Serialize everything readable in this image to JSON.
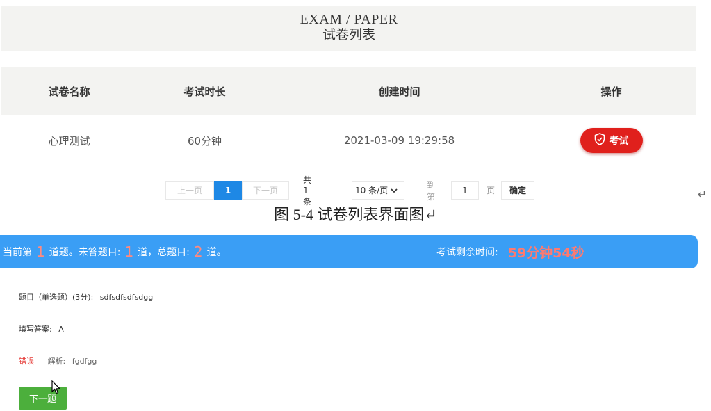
{
  "header": {
    "title_en": "EXAM / PAPER",
    "title_zh": "试卷列表"
  },
  "table": {
    "columns": [
      "试卷名称",
      "考试时长",
      "创建时间",
      "操作"
    ],
    "rows": [
      {
        "name": "心理测试",
        "duration": "60分钟",
        "created": "2021-03-09 19:29:58",
        "action": "考试"
      }
    ]
  },
  "pagination": {
    "prev": "上一页",
    "current": "1",
    "next": "下一页",
    "total": "共 1 条",
    "page_size": "10 条/页",
    "goto_label": "到第",
    "goto_value": "1",
    "page_unit": "页",
    "confirm": "确定"
  },
  "caption": "图 5-4  试卷列表界面图↵",
  "return_mark": "↵",
  "status": {
    "prefix": "当前第",
    "current": "1",
    "unanswered_label": "道题。未答题目:",
    "unanswered": "1",
    "total_label": "道，总题目:",
    "total": "2",
    "suffix": "道。",
    "time_label": "考试剩余时间:",
    "time_value": "59分钟54秒"
  },
  "question": {
    "title_label": "题目（单选题）(3分):",
    "title_value": "sdfsdfsdfsdgg",
    "answer_label": "填写答案:",
    "answer_value": "A",
    "result": "错误",
    "analysis_label": "解析:",
    "analysis_value": "fgdfgg",
    "next_button": "下一题"
  },
  "colors": {
    "accent": "#3a9ef5",
    "danger": "#e0201c",
    "success": "#4caf3c",
    "pager_active": "#1e88e5"
  },
  "icons": {
    "exam": "shield-check-icon",
    "dropdown": "chevron-down-icon",
    "cursor": "mouse-pointer-icon"
  }
}
